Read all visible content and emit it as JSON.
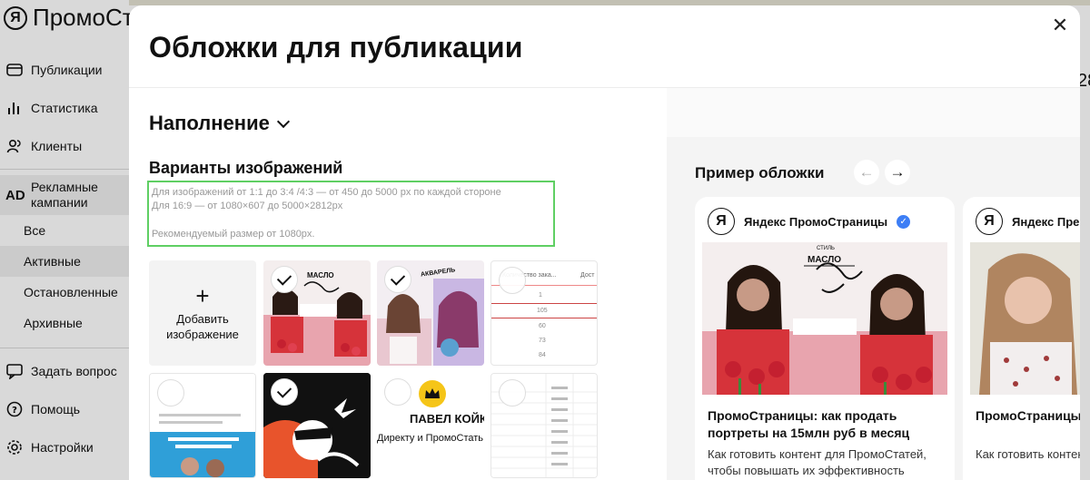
{
  "app": {
    "logo_text": "ПромоСт",
    "logo_mark": "Я",
    "right_peek": "28"
  },
  "sidebar": {
    "items": [
      {
        "label": "Публикации"
      },
      {
        "label": "Статистика"
      },
      {
        "label": "Клиенты"
      }
    ],
    "ads_mark": "AD",
    "ads_label": "Рекламные кампании",
    "sub_items": [
      {
        "label": "Все"
      },
      {
        "label": "Активные"
      },
      {
        "label": "Остановленные"
      },
      {
        "label": "Архивные"
      }
    ],
    "bottom_items": [
      {
        "label": "Задать вопрос"
      },
      {
        "label": "Помощь"
      },
      {
        "label": "Настройки"
      }
    ]
  },
  "modal": {
    "title": "Обложки для публикации",
    "close_symbol": "✕",
    "section_title": "Наполнение",
    "variants_title": "Варианты изображений",
    "hint_line1": "Для изображений от 1:1 до 3:4 /4:3 — от 450 до 5000 px по каждой стороне",
    "hint_line2": "Для 16:9 — от 1080×607 до 5000×2812px",
    "hint_line3": "Рекомендуемый размер от 1080px.",
    "add_plus": "+",
    "add_label": "Добавить изображение",
    "tiles": [
      {
        "selected": true,
        "label": "МАСЛО"
      },
      {
        "selected": true,
        "label": "АКВАРЕЛЬ"
      },
      {
        "selected": false,
        "headers": [
          "Количество зака...",
          "Дост"
        ],
        "values": [
          "1",
          "105",
          "60",
          "73",
          "84"
        ]
      },
      {
        "selected": false
      },
      {
        "selected": true
      },
      {
        "selected": false,
        "text1": "ПАВЕЛ КОЙКО",
        "text2": "Директу и ПромоСтать"
      },
      {
        "selected": false
      }
    ],
    "example_title": "Пример обложки",
    "prev_arrow": "←",
    "next_arrow": "→",
    "cards": [
      {
        "brand": "Яндекс ПромоСтраницы",
        "verified": "✓",
        "title": "ПромоСтраницы: как продать портреты на 15млн руб в месяц",
        "desc": "Как готовить контент для ПромоСтатей, чтобы повышать их эффективность",
        "img_label": "МАСЛО",
        "img_sub": "СТИЛЬ"
      },
      {
        "brand": "Яндекс Пре",
        "title": "ПромоСтраницы: как прода",
        "desc": "Как готовить контент для"
      }
    ]
  },
  "colors": {
    "highlight": "#5fcf63",
    "verified": "#3d7ef5",
    "accent_pink": "#e8a4ae",
    "flower_red": "#d6333a"
  }
}
